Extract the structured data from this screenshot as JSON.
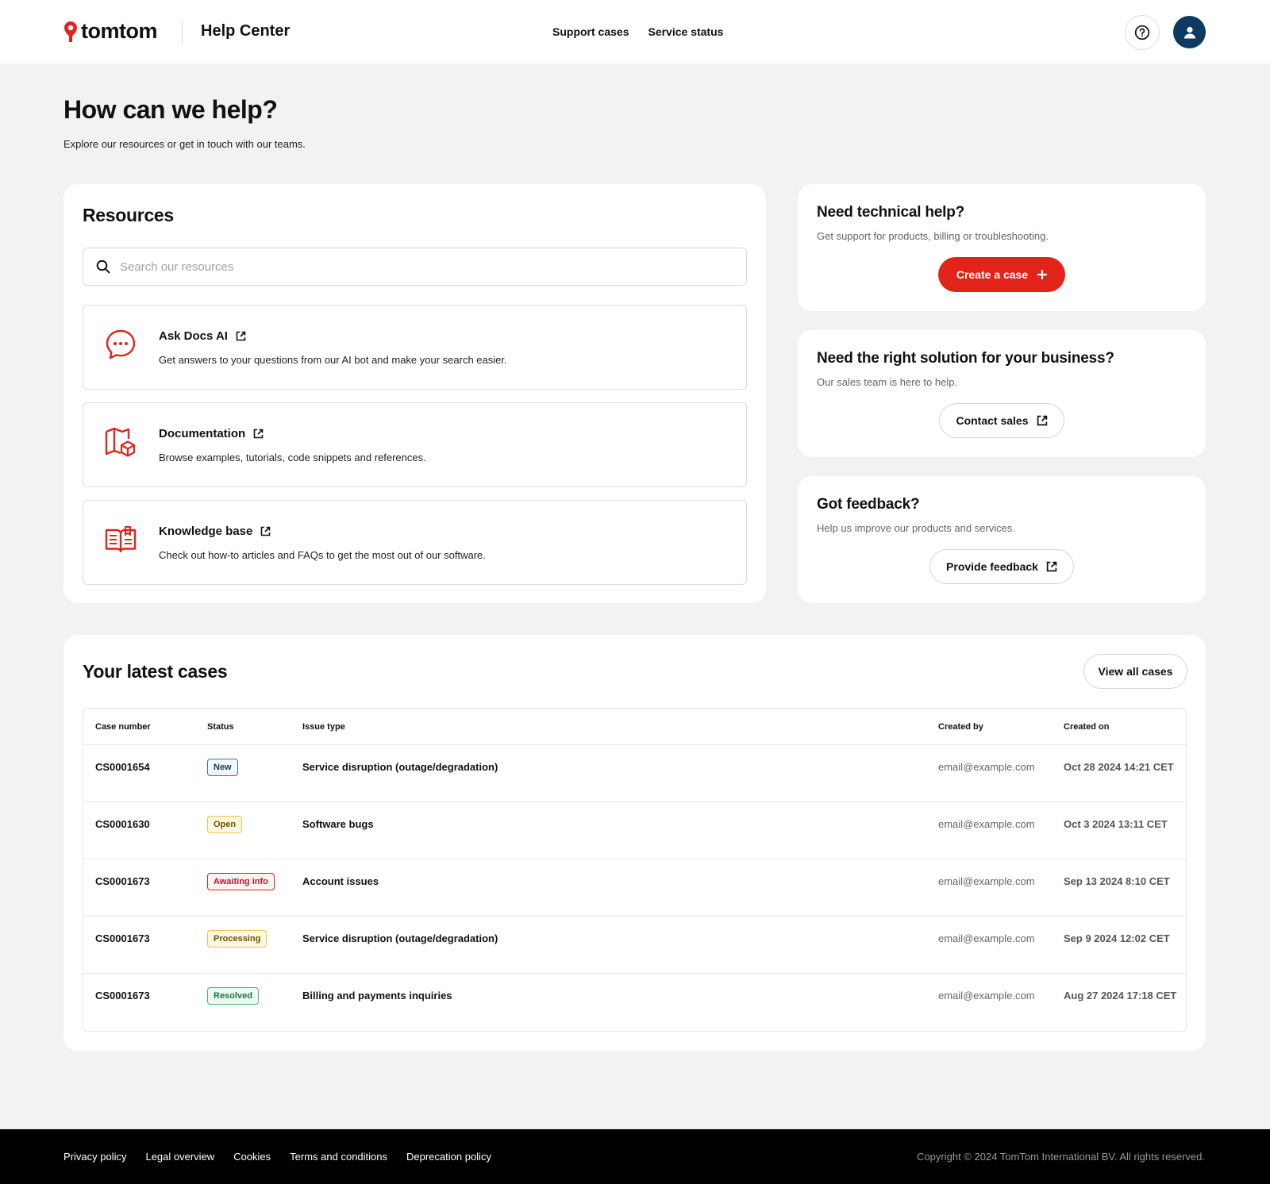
{
  "header": {
    "brand": "tomtom",
    "title": "Help Center",
    "nav": [
      "Support cases",
      "Service status"
    ]
  },
  "hero": {
    "title": "How can we help?",
    "subtitle": "Explore our resources or get in touch with our teams."
  },
  "resources": {
    "title": "Resources",
    "search_placeholder": "Search our resources",
    "items": [
      {
        "name": "Ask Docs AI",
        "desc": "Get answers to your questions from our AI bot and make your search easier.",
        "icon": "chat-bubble-icon"
      },
      {
        "name": "Documentation",
        "desc": "Browse examples, tutorials, code snippets and references.",
        "icon": "map-cube-icon"
      },
      {
        "name": "Knowledge base",
        "desc": "Check out how-to articles and FAQs to get the most out of our software.",
        "icon": "open-book-icon"
      }
    ]
  },
  "technical": {
    "title": "Need technical help?",
    "subtitle": "Get support for products, billing or troubleshooting.",
    "button": "Create a case"
  },
  "sales": {
    "title": "Need the right solution for your business?",
    "subtitle": "Our sales team is here to help.",
    "button": "Contact sales"
  },
  "feedback": {
    "title": "Got feedback?",
    "subtitle": "Help us improve our products and services.",
    "button": "Provide feedback"
  },
  "cases": {
    "title": "Your latest cases",
    "view_all": "View all cases",
    "columns": [
      "Case number",
      "Status",
      "Issue type",
      "Created by",
      "Created on"
    ],
    "rows": [
      {
        "case": "CS0001654",
        "status": "New",
        "issue": "Service disruption (outage/degradation)",
        "by": "email@example.com",
        "on": "Oct 28 2024 14:21 CET"
      },
      {
        "case": "CS0001630",
        "status": "Open",
        "issue": "Software bugs",
        "by": "email@example.com",
        "on": "Oct 3 2024 13:11 CET"
      },
      {
        "case": "CS0001673",
        "status": "Awaiting info",
        "issue": "Account issues",
        "by": "email@example.com",
        "on": "Sep 13 2024 8:10 CET"
      },
      {
        "case": "CS0001673",
        "status": "Processing",
        "issue": "Service disruption (outage/degradation)",
        "by": "email@example.com",
        "on": "Sep 9 2024 12:02 CET"
      },
      {
        "case": "CS0001673",
        "status": "Resolved",
        "issue": "Billing and payments inquiries",
        "by": "email@example.com",
        "on": "Aug 27 2024 17:18 CET"
      }
    ]
  },
  "footer": {
    "links": [
      "Privacy policy",
      "Legal overview",
      "Cookies",
      "Terms and conditions",
      "Deprecation policy"
    ],
    "copyright": "Copyright © 2024 TomTom International BV. All rights reserved."
  },
  "colors": {
    "accent": "#e2231a",
    "avatar": "#0d3a63",
    "background": "#f2f2f2",
    "footer": "#000000"
  }
}
